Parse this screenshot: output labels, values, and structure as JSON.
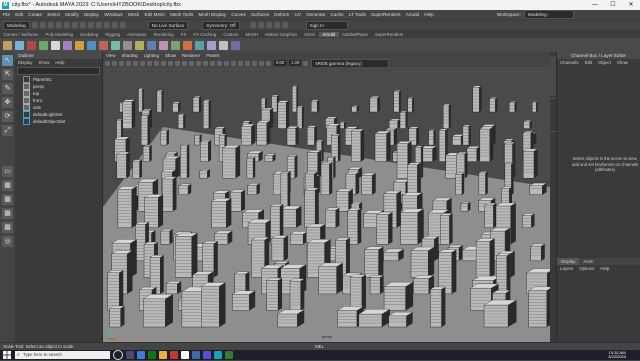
{
  "window": {
    "title": "city.fbx* - Autodesk MAYA 2023: C:\\Users\\HYZBOOK\\Desktop\\city.fbx",
    "logo_letter": "M",
    "min_glyph": "—",
    "max_glyph": "☐",
    "close_glyph": "✕"
  },
  "menubar": {
    "items": [
      "File",
      "Edit",
      "Create",
      "Select",
      "Modify",
      "Display",
      "Windows",
      "Mesh",
      "Edit Mesh",
      "Mesh Tools",
      "Mesh Display",
      "Curves",
      "Surfaces",
      "Deform",
      "UV",
      "Generate",
      "Cache",
      "LT Tools",
      "SuperRenders",
      "Arnold",
      "Help"
    ],
    "workspace_label": "Workspace:",
    "workspace_value": "Modeling - Standard*"
  },
  "statusline": {
    "mode": "Modeling",
    "no_live_surface": "No Live Surface",
    "symmetry": "Symmetry: Off",
    "sign_in": "Sign In"
  },
  "shelf": {
    "tabs": [
      "Curves / Surfaces",
      "Poly Modeling",
      "Sculpting",
      "Rigging",
      "Animation",
      "Rendering",
      "FX",
      "FX Caching",
      "Custom",
      "MASH",
      "Motion Graphics",
      "XGen",
      "Arnold",
      "AaDbaPhase",
      "SuperRenders"
    ],
    "active_tab": "Arnold",
    "icon_colors": [
      "#c0a060",
      "#7ab0d0",
      "#b04a4a",
      "#6aaa6a",
      "#d8d8d8",
      "#a080c0",
      "#d0a040",
      "#5090c0",
      "#c06060",
      "#70c0a0",
      "#909090",
      "#b0b060",
      "#6080b0",
      "#c090b0",
      "#80a070",
      "#d07040",
      "#5aa0a0",
      "#a0a0d0",
      "#c0c0c0",
      "#7070a0"
    ]
  },
  "toolbox": {
    "items": [
      "↖",
      "⇱",
      "✎",
      "✥",
      "⟳",
      "⤢",
      "▭",
      "▦",
      "▦",
      "▦",
      "▦",
      "◎"
    ]
  },
  "outliner": {
    "title": "Outliner",
    "menus": [
      "Display",
      "Show",
      "Help"
    ],
    "items": [
      {
        "label": "Plane001",
        "kind": "mesh"
      },
      {
        "label": "persp",
        "kind": "cam"
      },
      {
        "label": "top",
        "kind": "cam"
      },
      {
        "label": "front",
        "kind": "cam"
      },
      {
        "label": "side",
        "kind": "cam"
      },
      {
        "label": "defaultLightSet",
        "kind": "set"
      },
      {
        "label": "defaultObjectSet",
        "kind": "set"
      }
    ]
  },
  "viewport": {
    "menus": [
      "View",
      "Shading",
      "Lighting",
      "Show",
      "Renderer",
      "Panels"
    ],
    "near_clip": "0.00",
    "far_clip": "1.00",
    "color_space": "sRGB gamma (legacy)",
    "camera_label": "persp",
    "axis_label": "Y"
  },
  "channel_box": {
    "header": "Channel Box / Layer Editor",
    "menus": [
      "Channels",
      "Edit",
      "Object",
      "Show"
    ],
    "message": "Select objects in the scene to view, add and set keyframes on channels (attributes)",
    "layer_tabs": [
      "Display",
      "Anim"
    ],
    "layer_menus": [
      "Layers",
      "Options",
      "Help"
    ]
  },
  "side_tabs": [
    "Channel Box / Layer Editor",
    "Attribute Editor",
    "Modeling Toolkit"
  ],
  "statusbar": {
    "left": "Scale Tool: Select an object to scale.",
    "mel": "MEL"
  },
  "taskbar": {
    "search_placeholder": "Type here to search",
    "icon_colors": [
      "#ffffff",
      "#4a4a6a",
      "#3a7bd5",
      "#0e7a0d",
      "#e8b23a",
      "#c5363a",
      "#ffffff",
      "#3a6ea5",
      "#5a4fcf",
      "#1aa3b8",
      "#2e7d32"
    ],
    "time": "10:32 AM",
    "date": "3/22/2023"
  }
}
